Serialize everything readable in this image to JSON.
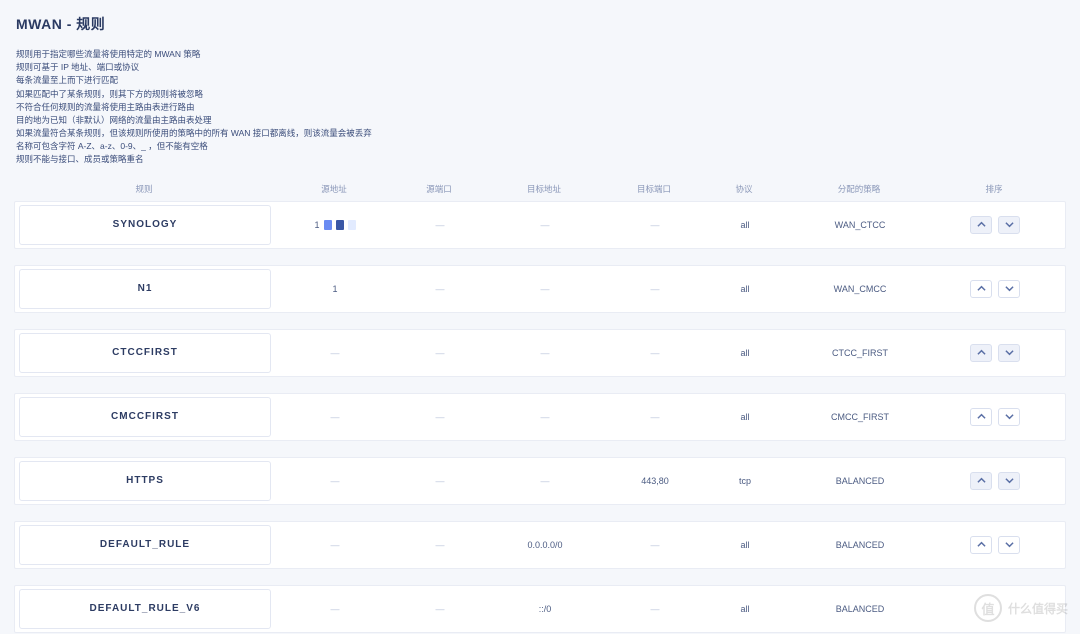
{
  "title": "MWAN - 规则",
  "description": [
    "规则用于指定哪些流量将使用特定的 MWAN 策略",
    "规则可基于 IP 地址、端口或协议",
    "每条流量至上而下进行匹配",
    "如果匹配中了某条规则，则其下方的规则将被忽略",
    "不符合任何规则的流量将使用主路由表进行路由",
    "目的地为已知（非默认）网络的流量由主路由表处理",
    "如果流量符合某条规则，但该规则所使用的策略中的所有 WAN 接口都离线，则该流量会被丢弃",
    "名称可包含字符 A-Z、a-z、0-9、_ ，但不能有空格",
    "规则不能与接口、成员或策略重名"
  ],
  "columns": {
    "rule": "规则",
    "src_addr": "源地址",
    "src_port": "源端口",
    "dest_addr": "目标地址",
    "dest_port": "目标端口",
    "protocol": "协议",
    "policy": "分配的策略",
    "sort": "排序"
  },
  "rows": [
    {
      "name": "SYNOLOGY",
      "src_addr_special": true,
      "src_addr": "1",
      "src_port": "—",
      "dest_addr": "—",
      "dest_port": "—",
      "protocol": "all",
      "policy": "WAN_CTCC",
      "alt": true
    },
    {
      "name": "N1",
      "src_addr": "1",
      "src_port": "—",
      "dest_addr": "—",
      "dest_port": "—",
      "protocol": "all",
      "policy": "WAN_CMCC",
      "alt": false
    },
    {
      "name": "CTCCFIRST",
      "src_addr": "—",
      "src_port": "—",
      "dest_addr": "—",
      "dest_port": "—",
      "protocol": "all",
      "policy": "CTCC_FIRST",
      "alt": true
    },
    {
      "name": "CMCCFIRST",
      "src_addr": "—",
      "src_port": "—",
      "dest_addr": "—",
      "dest_port": "—",
      "protocol": "all",
      "policy": "CMCC_FIRST",
      "alt": false
    },
    {
      "name": "HTTPS",
      "src_addr": "—",
      "src_port": "—",
      "dest_addr": "—",
      "dest_port": "443,80",
      "protocol": "tcp",
      "policy": "BALANCED",
      "alt": true
    },
    {
      "name": "DEFAULT_RULE",
      "src_addr": "—",
      "src_port": "—",
      "dest_addr": "0.0.0.0/0",
      "dest_port": "—",
      "protocol": "all",
      "policy": "BALANCED",
      "alt": false
    },
    {
      "name": "DEFAULT_RULE_V6",
      "src_addr": "—",
      "src_port": "—",
      "dest_addr": "::/0",
      "dest_port": "—",
      "protocol": "all",
      "policy": "BALANCED",
      "alt": false,
      "no_ctrls": true
    }
  ],
  "watermark": "什么值得买"
}
